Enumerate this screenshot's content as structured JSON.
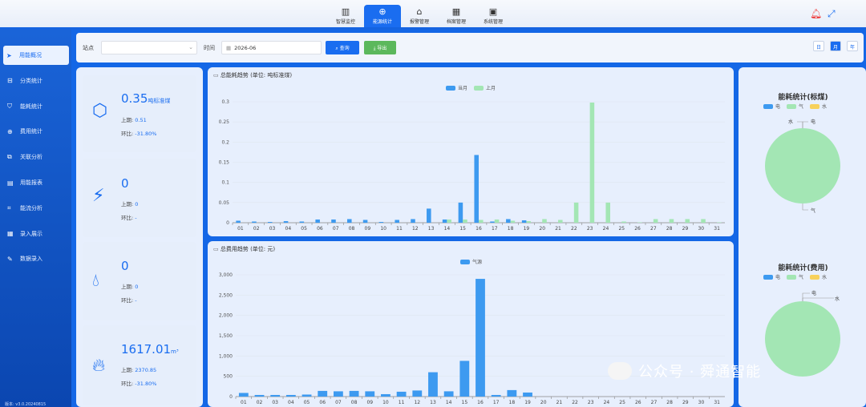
{
  "nav": [
    {
      "label": "智慧监控",
      "icon": "bar-chart-icon",
      "active": false
    },
    {
      "label": "能源统计",
      "icon": "energy-icon",
      "active": true
    },
    {
      "label": "报警管理",
      "icon": "alarm-icon",
      "active": false
    },
    {
      "label": "档案管理",
      "icon": "archive-icon",
      "active": false
    },
    {
      "label": "系统管理",
      "icon": "monitor-icon",
      "active": false
    }
  ],
  "sidebar": {
    "items": [
      {
        "label": "用能概况",
        "icon": "send-icon",
        "active": true
      },
      {
        "label": "分类统计",
        "icon": "category-icon",
        "active": false
      },
      {
        "label": "能耗统计",
        "icon": "stats-icon",
        "active": false
      },
      {
        "label": "费用统计",
        "icon": "cost-icon",
        "active": false
      },
      {
        "label": "关联分析",
        "icon": "link-icon",
        "active": false
      },
      {
        "label": "用能报表",
        "icon": "report-icon",
        "active": false
      },
      {
        "label": "能流分析",
        "icon": "flow-icon",
        "active": false
      },
      {
        "label": "录入展示",
        "icon": "grid-icon",
        "active": false
      },
      {
        "label": "数据录入",
        "icon": "edit-icon",
        "active": false
      }
    ],
    "version": "版本: v3.0.20240815"
  },
  "filter": {
    "site_label": "站点",
    "time_label": "时间",
    "date_value": "2026-06",
    "query_label": "查询",
    "export_label": "导出",
    "toggle_labels": [
      "日",
      "月",
      "年"
    ]
  },
  "cards": [
    {
      "icon": "electric-hex-icon",
      "value": "0.35",
      "unit": "吨标准煤",
      "prev_label": "上期:",
      "prev_value": "0.51",
      "ratio_label": "环比:",
      "ratio_value": "-31.80%"
    },
    {
      "icon": "lightning-icon",
      "value": "0",
      "unit": "",
      "prev_label": "上期:",
      "prev_value": "0",
      "ratio_label": "环比:",
      "ratio_value": "-"
    },
    {
      "icon": "water-drop-icon",
      "value": "0",
      "unit": "",
      "prev_label": "上期:",
      "prev_value": "0",
      "ratio_label": "环比:",
      "ratio_value": "-"
    },
    {
      "icon": "flame-icon",
      "value": "1617.01",
      "unit": "m³",
      "prev_label": "上期:",
      "prev_value": "2370.85",
      "ratio_label": "环比:",
      "ratio_value": "-31.80%"
    }
  ],
  "colors": {
    "current": "#3d9af0",
    "last": "#a3e6b4",
    "gas": "#a3e6b4",
    "water": "#f7d15c",
    "accent": "#1a6df0"
  },
  "chart_data": [
    {
      "type": "bar",
      "title": "总能耗趋势 (单位: 吨标准煤)",
      "categories": [
        "01",
        "02",
        "03",
        "04",
        "05",
        "06",
        "07",
        "08",
        "09",
        "10",
        "11",
        "12",
        "13",
        "14",
        "15",
        "16",
        "17",
        "18",
        "19",
        "20",
        "21",
        "22",
        "23",
        "24",
        "25",
        "26",
        "27",
        "28",
        "29",
        "30",
        "31"
      ],
      "series": [
        {
          "name": "当月",
          "values": [
            0.005,
            0.003,
            0.002,
            0.004,
            0.003,
            0.008,
            0.008,
            0.009,
            0.007,
            0.002,
            0.007,
            0.009,
            0.035,
            0.008,
            0.05,
            0.168,
            0.003,
            0.009,
            0.006,
            0.0,
            0.0,
            0.0,
            0.0,
            0.0,
            0.0,
            0.0,
            0.0,
            0.0,
            0.0,
            0.0,
            0.0
          ]
        },
        {
          "name": "上月",
          "values": [
            0.0,
            0.0,
            0.0,
            0.0,
            0.0,
            0.0,
            0.0,
            0.0,
            0.0,
            0.0,
            0.0,
            0.0,
            0.0,
            0.008,
            0.008,
            0.007,
            0.008,
            0.005,
            0.004,
            0.009,
            0.007,
            0.05,
            0.298,
            0.05,
            0.003,
            0.001,
            0.009,
            0.009,
            0.009,
            0.009,
            0.001
          ]
        }
      ],
      "ylim": [
        0,
        0.3
      ],
      "yticks": [
        "0",
        "0.05",
        "0.1",
        "0.15",
        "0.2",
        "0.25",
        "0.3"
      ]
    },
    {
      "type": "bar",
      "title": "总费用趋势 (单位: 元)",
      "categories": [
        "01",
        "02",
        "03",
        "04",
        "05",
        "06",
        "07",
        "08",
        "09",
        "10",
        "11",
        "12",
        "13",
        "14",
        "15",
        "16",
        "17",
        "18",
        "19",
        "20",
        "21",
        "22",
        "23",
        "24",
        "25",
        "26",
        "27",
        "28",
        "29",
        "30",
        "31"
      ],
      "series": [
        {
          "name": "气源",
          "values": [
            90,
            40,
            40,
            40,
            50,
            140,
            130,
            140,
            130,
            60,
            120,
            150,
            600,
            130,
            880,
            2900,
            40,
            160,
            100,
            0,
            0,
            0,
            0,
            0,
            0,
            0,
            0,
            0,
            0,
            0,
            0
          ]
        }
      ],
      "ylim": [
        0,
        3000
      ],
      "yticks": [
        "0",
        "500",
        "1,000",
        "1,500",
        "2,000",
        "2,500",
        "3,000"
      ]
    },
    {
      "type": "pie",
      "title": "能耗统计(标煤)",
      "legend": [
        "电",
        "气",
        "水"
      ],
      "labels": [
        "水",
        "电",
        "气"
      ],
      "values": [
        0,
        0,
        1
      ]
    },
    {
      "type": "pie",
      "title": "能耗统计(费用)",
      "legend": [
        "电",
        "气",
        "水"
      ],
      "labels": [
        "电",
        "水"
      ],
      "values": [
        0,
        0,
        1
      ]
    }
  ],
  "watermark": "公众号 · 舜通智能"
}
